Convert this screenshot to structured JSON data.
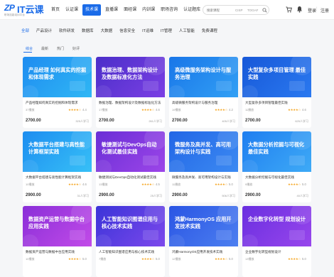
{
  "header": {
    "logo_mark": "ZP",
    "logo_text": "IT云课",
    "logo_sub": "职场技能培训平台",
    "nav": [
      {
        "label": "首页"
      },
      {
        "label": "认证课"
      },
      {
        "label": "技术课",
        "active": true
      },
      {
        "label": "直播课"
      },
      {
        "label": "面经课"
      },
      {
        "label": "内训课"
      },
      {
        "label": "职场咨询"
      },
      {
        "label": "认证题库"
      }
    ],
    "search_placeholder": "搜索课程",
    "search_tags": [
      "CISP",
      "TOGAF"
    ],
    "login": "登录",
    "separator": "|",
    "register": "注册"
  },
  "categories": [
    {
      "label": "全部",
      "active": true
    },
    {
      "label": "产品设计"
    },
    {
      "label": "软件研发"
    },
    {
      "label": "数据库"
    },
    {
      "label": "大数据"
    },
    {
      "label": "信息安全"
    },
    {
      "label": "IT运维"
    },
    {
      "label": "IT管理"
    },
    {
      "label": "人工智能"
    },
    {
      "label": "免费课程"
    }
  ],
  "sort_tabs": [
    {
      "label": "综合",
      "active": true
    },
    {
      "label": "最新"
    },
    {
      "label": "热门"
    },
    {
      "label": "好评"
    }
  ],
  "courses": [
    {
      "thumb_title": "产品经理 如何真实的挖掘和体现需求",
      "thumb_lines": [
        "产品经理 如何",
        "真实的挖掘和体现需求"
      ],
      "bg": [
        "#1f8cf0",
        "#2fb7f5"
      ],
      "title": "产品经理如何真实的挖掘和体现需求",
      "users": "37播放",
      "stars": "★★★★☆",
      "rating": "4.4",
      "price": "2700.00",
      "buyers": "325人学习"
    },
    {
      "thumb_title": "数据治理、数据架构设计及数据标准化方法",
      "thumb_lines": [
        "数据治理、数据架构设计",
        "及数据标准化方法"
      ],
      "bg": [
        "#4b2fc9",
        "#7b3fe4"
      ],
      "title": "数据治理、数据架构设计及数据标准化方法",
      "users": "17播放",
      "stars": "★★★★☆",
      "rating": "4.6",
      "price": "2700.00",
      "buyers": "261人学习"
    },
    {
      "thumb_title": "高级微服务架构设计与服务治理",
      "thumb_lines": [
        "高级微服务架构设计",
        "与服务治理"
      ],
      "bg": [
        "#1976e8",
        "#32a0f5"
      ],
      "title": "高级微服务架构设计与服务治理",
      "users": "19播放",
      "stars": "★★★★☆",
      "rating": "4.2",
      "price": "2700.00",
      "buyers": "405人学习"
    },
    {
      "thumb_title": "大型复杂多项目管理 最佳实践",
      "thumb_lines": [
        "大型复杂多项目管理",
        "最佳实践"
      ],
      "bg": [
        "#1758d8",
        "#2a79f0"
      ],
      "title": "大型复杂多项目管理最佳实践",
      "users": "11播放",
      "stars": "★★★★☆",
      "rating": "4.6",
      "price": "2700.00",
      "buyers": "625人学习"
    },
    {
      "thumb_title": "大数据平台搭建与高性能计算框架实践",
      "thumb_lines": [
        "大数据平台搭建",
        "与高性能计算框架实践"
      ],
      "bg": [
        "#1d8df0",
        "#37c0f7"
      ],
      "title": "大数据平台搭建与高性能计算框架实践",
      "users": "10播放",
      "stars": "★★★★☆",
      "rating": "4.6",
      "price": "2900.00",
      "buyers": "31人学习"
    },
    {
      "thumb_title": "敏捷测试与DevOps自动化测试最佳实践",
      "thumb_lines": [
        "敏捷测试与DevOps",
        "自动化测试最佳实践"
      ],
      "bg": [
        "#6a2fd6",
        "#9c45e8"
      ],
      "title": "敏捷测试与DevOps自动化测试最佳实践",
      "users": "13播放",
      "stars": "★★★★☆",
      "rating": "4.5",
      "price": "2900.00",
      "buyers": "25人学习"
    },
    {
      "thumb_title": "微服务及高并发、高可用架构设计与实践",
      "thumb_lines": [
        "微服务及高并发、高可用",
        "架构设计与实践"
      ],
      "bg": [
        "#2266e6",
        "#3c8af2"
      ],
      "title": "微服务及高并发、高可用架构设计与实践",
      "users": "11播放",
      "stars": "★★★★☆",
      "rating": "5.0",
      "price": "2900.00",
      "buyers": "506人学习"
    },
    {
      "thumb_title": "大数据分析挖掘与可视化最佳实践",
      "thumb_lines": [
        "大数据分析挖掘",
        "与可视化最佳实践"
      ],
      "bg": [
        "#1f7ef0",
        "#3eaaf6"
      ],
      "title": "大数据分析挖掘与可视化最佳实践",
      "users": "9播放",
      "stars": "★★★★☆",
      "rating": "5.0",
      "price": "2900.00",
      "buyers": "40人学习"
    },
    {
      "thumb_title": "数据资产运营与数据中台应用实践",
      "thumb_lines": [
        "数据资产运营",
        "与数据中台应用实践"
      ],
      "bg": [
        "#8a2fd8",
        "#c24be8"
      ],
      "title": "数据资产运营与数据中台应用实践",
      "users": "10播放",
      "stars": "★★★★☆",
      "rating": "5.0",
      "price": "",
      "buyers": ""
    },
    {
      "thumb_title": "人工智能知识图谱应用与核心技术实践",
      "thumb_lines": [
        "人工智能知识图谱应用",
        "与核心技术实践"
      ],
      "bg": [
        "#3b34d8",
        "#7c48ec"
      ],
      "title": "人工智能知识图谱应用与核心技术实践",
      "users": "7播放",
      "stars": "★★★★☆",
      "rating": "5.0",
      "price": "",
      "buyers": ""
    },
    {
      "thumb_title": "鸿蒙HarmonyOS 应用开发技术实践",
      "thumb_lines": [
        "鸿蒙HarmonyOS",
        "应用开发技术实践"
      ],
      "bg": [
        "#2a55e4",
        "#4c7ff0"
      ],
      "title": "鸿蒙HarmonyOS应用开发技术实践",
      "users": "12播放",
      "stars": "★★★★☆",
      "rating": "5.0",
      "price": "",
      "buyers": ""
    },
    {
      "thumb_title": "企业数字化转型 规划设计",
      "thumb_lines": [
        "企业数字化转型",
        "规划设计"
      ],
      "bg": [
        "#6a2fe0",
        "#9846ec"
      ],
      "title": "企业数字化转型规划设计",
      "users": "13播放",
      "stars": "★★★★☆",
      "rating": "5.0",
      "price": "",
      "buyers": ""
    }
  ]
}
